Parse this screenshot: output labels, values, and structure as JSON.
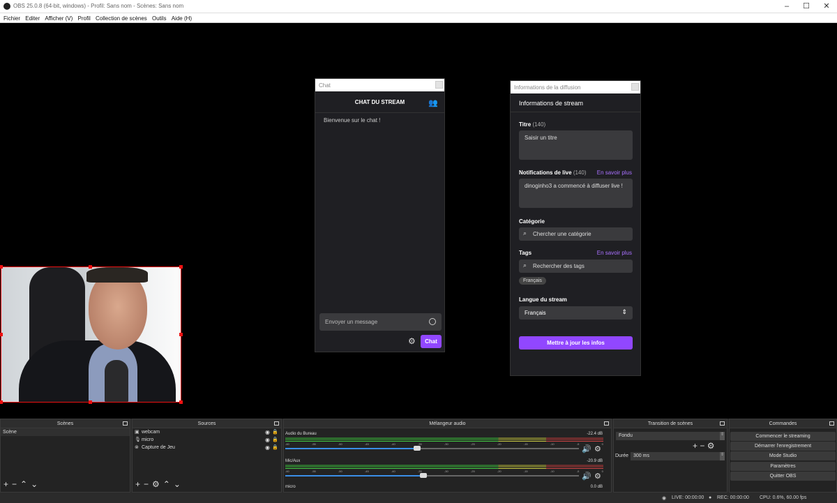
{
  "window": {
    "title": "OBS 25.0.8 (64-bit, windows) - Profil: Sans nom - Scènes: Sans nom"
  },
  "menu": [
    "Fichier",
    "Editer",
    "Afficher (V)",
    "Profil",
    "Collection de scènes",
    "Outils",
    "Aide (H)"
  ],
  "chat": {
    "dock_title": "Chat",
    "header": "CHAT DU STREAM",
    "welcome": "Bienvenue sur le chat !",
    "input_placeholder": "Envoyer un message",
    "send_label": "Chat"
  },
  "info": {
    "dock_title": "Informations de la diffusion",
    "header": "Informations de stream",
    "title_label": "Titre",
    "title_count": "(140)",
    "title_placeholder": "Saisir un titre",
    "notif_label": "Notifications de live",
    "notif_count": "(140)",
    "learn_more": "En savoir plus",
    "notif_text": "dinoginho3 a commencé à diffuser live !",
    "category_label": "Catégorie",
    "category_placeholder": "Chercher une catégorie",
    "tags_label": "Tags",
    "tags_learn_more": "En savoir plus",
    "tags_placeholder": "Rechercher des tags",
    "tag_value": "Français",
    "lang_label": "Langue du stream",
    "lang_value": "Français",
    "update_button": "Mettre à jour les infos"
  },
  "scenes": {
    "title": "Scènes",
    "items": [
      "Scène"
    ]
  },
  "sources": {
    "title": "Sources",
    "items": [
      "webcam",
      "micro",
      "Capture de Jeu"
    ]
  },
  "mixer": {
    "title": "Mélangeur audio",
    "ticks": [
      "-60",
      "-55",
      "-50",
      "-45",
      "-40",
      "-35",
      "-30",
      "-25",
      "-20",
      "-15",
      "-10",
      "-5",
      "0"
    ],
    "tracks": [
      {
        "name": "Audio du Bureau",
        "db": "-22.4 dB",
        "level": 0.45
      },
      {
        "name": "Mic/Aux",
        "db": "-20.9 dB",
        "level": 0.47
      },
      {
        "name": "micro",
        "db": "0.0 dB",
        "level": 1.0
      }
    ]
  },
  "transitions": {
    "title": "Transition de scènes",
    "selected": "Fondu",
    "duration_label": "Durée",
    "duration_value": "300 ms"
  },
  "commands": {
    "title": "Commandes",
    "buttons": [
      "Commencer le streaming",
      "Démarrer l'enregistrement",
      "Mode Studio",
      "Paramètres",
      "Quitter OBS"
    ]
  },
  "status": {
    "live": "LIVE: 00:00:00",
    "rec": "REC: 00:00:00",
    "cpu": "CPU: 0.6%, 60.00 fps"
  },
  "colors": {
    "twitch_purple": "#9147ff",
    "link_purple": "#a970ff",
    "selection_red": "#ee1111"
  }
}
